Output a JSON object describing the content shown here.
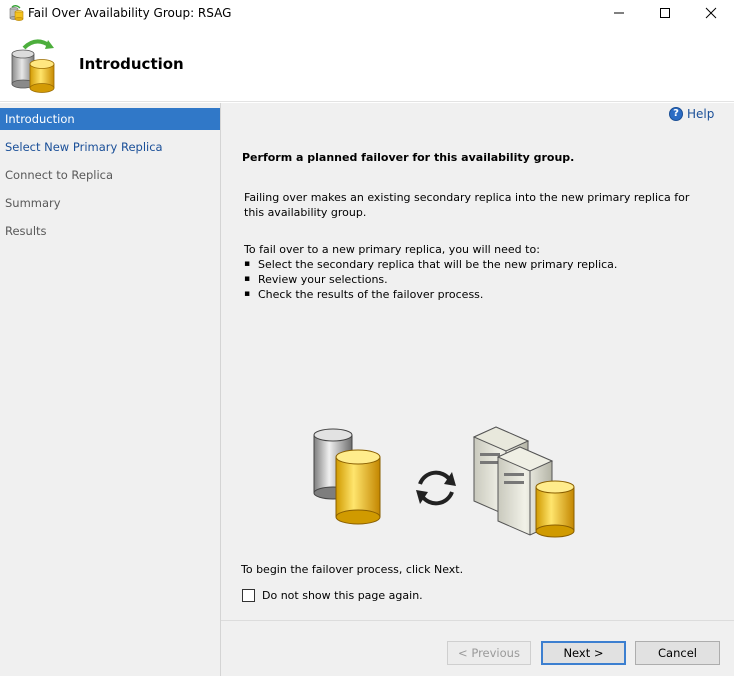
{
  "window": {
    "title": "Fail Over Availability Group: RSAG",
    "controls": [
      "minimize-icon",
      "maximize-icon",
      "close-icon"
    ]
  },
  "header": {
    "title": "Introduction"
  },
  "sidebar": {
    "items": [
      {
        "label": "Introduction",
        "state": "active"
      },
      {
        "label": "Select New Primary Replica",
        "state": "link"
      },
      {
        "label": "Connect to Replica",
        "state": "disabled"
      },
      {
        "label": "Summary",
        "state": "disabled"
      },
      {
        "label": "Results",
        "state": "disabled"
      }
    ]
  },
  "content": {
    "help_label": "Help",
    "title": "Perform a planned failover for this availability group.",
    "paragraph1": "Failing over makes an existing secondary replica into the new primary replica for this availability group.",
    "paragraph2": "To fail over to a new primary replica, you will need to:",
    "steps": [
      "Select the secondary replica that will be the new primary replica.",
      "Review your selections.",
      "Check the results of the failover process."
    ],
    "begin_text": "To begin the failover process, click Next.",
    "dont_show_label": "Do not show this page again.",
    "dont_show_checked": false
  },
  "buttons": {
    "previous": "< Previous",
    "next": "Next >",
    "cancel": "Cancel"
  },
  "colors": {
    "active_nav": "#3078c8",
    "link": "#1a4f98",
    "panel_bg": "#f0f0f0"
  }
}
